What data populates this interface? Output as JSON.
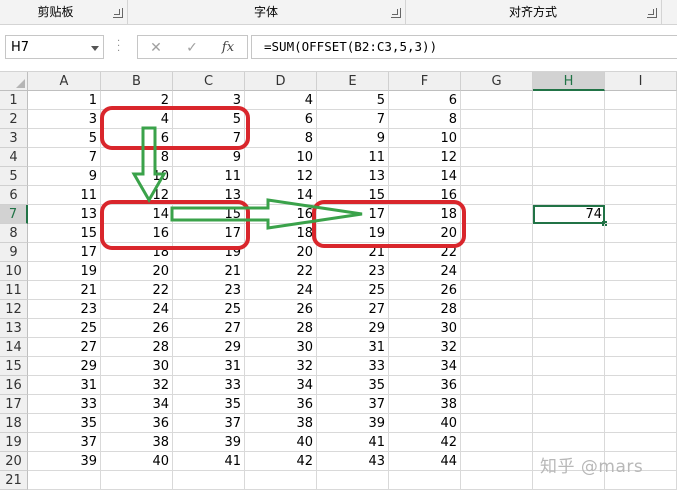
{
  "ribbon": {
    "groups": [
      "剪贴板",
      "字体",
      "对齐方式"
    ]
  },
  "formula_bar": {
    "name_box": "H7",
    "cancel_glyph": "✕",
    "enter_glyph": "✓",
    "fx_label": "fx",
    "formula": "=SUM(OFFSET(B2:C3,5,3))"
  },
  "sheet": {
    "columns": [
      "A",
      "B",
      "C",
      "D",
      "E",
      "F",
      "G",
      "H",
      "I"
    ],
    "rows": [
      "1",
      "2",
      "3",
      "4",
      "5",
      "6",
      "7",
      "8",
      "9",
      "10",
      "11",
      "12",
      "13",
      "14",
      "15",
      "16",
      "17",
      "18",
      "19",
      "20",
      "21"
    ],
    "data": [
      [
        "1",
        "2",
        "3",
        "4",
        "5",
        "6"
      ],
      [
        "3",
        "4",
        "5",
        "6",
        "7",
        "8"
      ],
      [
        "5",
        "6",
        "7",
        "8",
        "9",
        "10"
      ],
      [
        "7",
        "8",
        "9",
        "10",
        "11",
        "12"
      ],
      [
        "9",
        "10",
        "11",
        "12",
        "13",
        "14"
      ],
      [
        "11",
        "12",
        "13",
        "14",
        "15",
        "16"
      ],
      [
        "13",
        "14",
        "15",
        "16",
        "17",
        "18"
      ],
      [
        "15",
        "16",
        "17",
        "18",
        "19",
        "20"
      ],
      [
        "17",
        "18",
        "19",
        "20",
        "21",
        "22"
      ],
      [
        "19",
        "20",
        "21",
        "22",
        "23",
        "24"
      ],
      [
        "21",
        "22",
        "23",
        "24",
        "25",
        "26"
      ],
      [
        "23",
        "24",
        "25",
        "26",
        "27",
        "28"
      ],
      [
        "25",
        "26",
        "27",
        "28",
        "29",
        "30"
      ],
      [
        "27",
        "28",
        "29",
        "30",
        "31",
        "32"
      ],
      [
        "29",
        "30",
        "31",
        "32",
        "33",
        "34"
      ],
      [
        "31",
        "32",
        "33",
        "34",
        "35",
        "36"
      ],
      [
        "33",
        "34",
        "35",
        "36",
        "37",
        "38"
      ],
      [
        "35",
        "36",
        "37",
        "38",
        "39",
        "40"
      ],
      [
        "37",
        "38",
        "39",
        "40",
        "41",
        "42"
      ],
      [
        "39",
        "40",
        "41",
        "42",
        "43",
        "44"
      ],
      [
        "",
        "",
        "",
        "",
        "",
        ""
      ]
    ],
    "active_cell": {
      "ref": "H7",
      "value": "74"
    }
  },
  "annotations": {
    "box_color": "#d9262c",
    "arrow_color": "#3aa24a"
  },
  "watermark": "知乎 @mars",
  "colors": {
    "accent": "#217346"
  }
}
